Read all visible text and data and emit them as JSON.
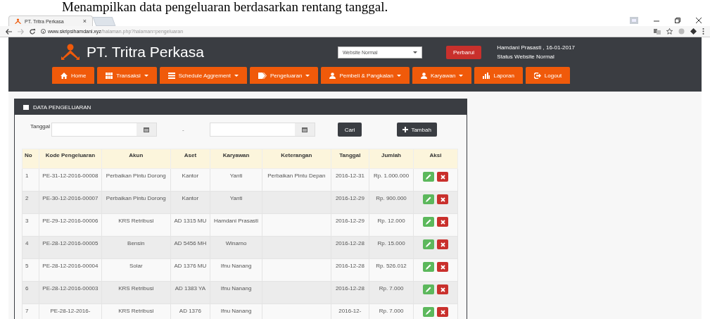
{
  "caption": "Menampilkan data pengeluaran berdasarkan rentang tanggal.",
  "browser": {
    "tab_title": "PT. Tritra Perkasa",
    "tab_close": "×",
    "url_host": "www.skripsihamdani.xyz",
    "url_path": "/halaman.php?halaman=pengeluaran"
  },
  "header": {
    "brand": "PT. Tritra Perkasa",
    "mode_select": "Website Normal",
    "update_button": "Perbarui",
    "user_line": "Hamdani Prasasti , 16-01-2017",
    "status_line": "Status Website  Normal"
  },
  "nav": [
    {
      "label": "Home",
      "dropdown": false
    },
    {
      "label": "Transaksi",
      "dropdown": true
    },
    {
      "label": "Schedule Aggrement",
      "dropdown": true
    },
    {
      "label": "Pengeluaran",
      "dropdown": true
    },
    {
      "label": "Pembeli & Pangkalan",
      "dropdown": true
    },
    {
      "label": "Karyawan",
      "dropdown": true
    },
    {
      "label": "Laporan",
      "dropdown": false
    },
    {
      "label": "Logout",
      "dropdown": false
    }
  ],
  "panel": {
    "title": "DATA PENGELUARAN",
    "filter_label": "Tanggal",
    "separator": "-",
    "search_button": "Cari",
    "add_button": "Tambah"
  },
  "table": {
    "columns": [
      "No",
      "Kode Pengeluaran",
      "Akun",
      "Aset",
      "Karyawan",
      "Keterangan",
      "Tanggal",
      "Jumlah",
      "Aksi"
    ],
    "rows": [
      {
        "cells": [
          "1",
          "PE-31-12-2016-00008",
          "Perbaikan Pintu Dorong",
          "Kantor",
          "Yanti",
          "Perbaikan Pintu Depan",
          "2016-12-31",
          "Rp. 1.000.000"
        ]
      },
      {
        "cells": [
          "2",
          "PE-30-12-2016-00007",
          "Perbaikan Pintu Dorong",
          "Kantor",
          "Yanti",
          "",
          "2016-12-29",
          "Rp. 900.000"
        ]
      },
      {
        "cells": [
          "3",
          "PE-29-12-2016-00006",
          "KRS Retribusi",
          "AD 1315 MU",
          "Hamdani Prasasti",
          "",
          "2016-12-29",
          "Rp. 12.000"
        ]
      },
      {
        "cells": [
          "4",
          "PE-28-12-2016-00005",
          "Bensin",
          "AD 5456 MH",
          "Winarno",
          "",
          "2016-12-28",
          "Rp. 15.000"
        ]
      },
      {
        "cells": [
          "5",
          "PE-28-12-2016-00004",
          "Solar",
          "AD 1376 MU",
          "Ifnu Nanang",
          "",
          "2016-12-28",
          "Rp. 526.012"
        ]
      },
      {
        "cells": [
          "6",
          "PE-28-12-2016-00003",
          "KRS Retribusi",
          "AD 1383 YA",
          "Ifnu Nanang",
          "",
          "2016-12-28",
          "Rp. 7.000"
        ]
      },
      {
        "cells": [
          "7",
          "PE-28-12-2016-",
          "KRS Retribusi",
          "AD 1376",
          "Ifnu Nanang",
          "",
          "2016-12-",
          "Rp. 7.000"
        ]
      }
    ]
  }
}
